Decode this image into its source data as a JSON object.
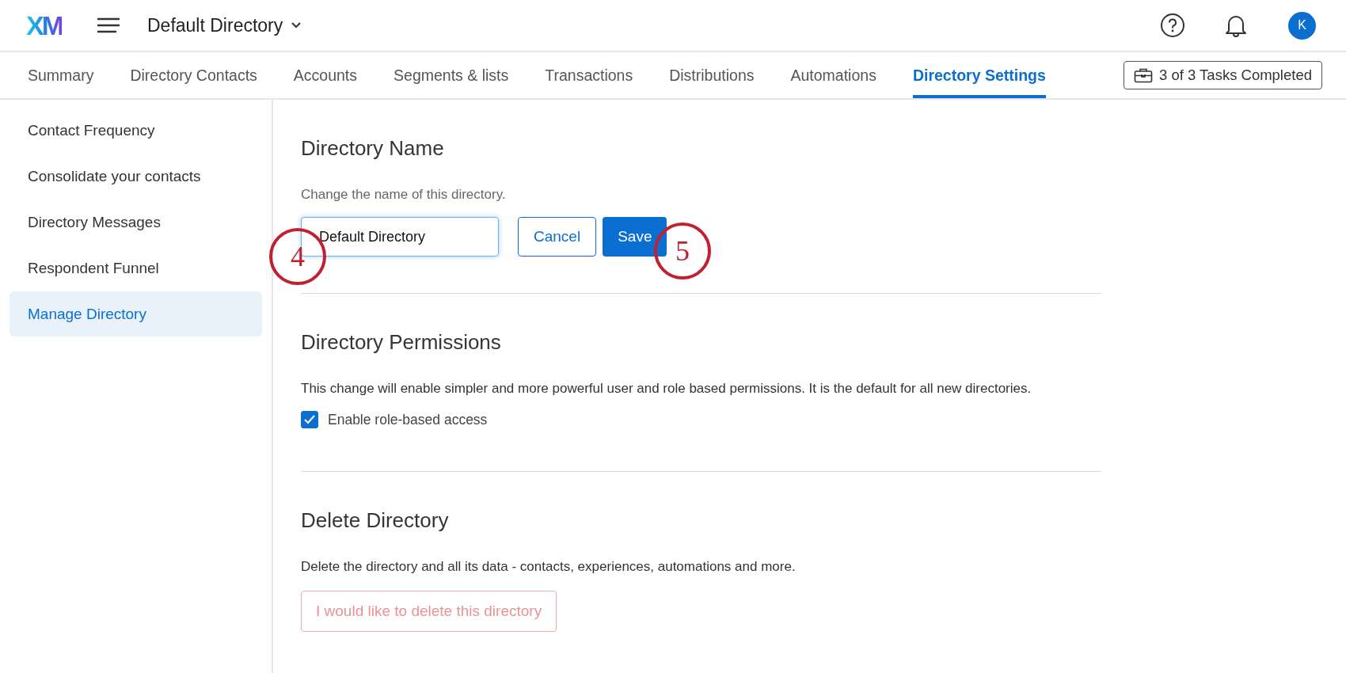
{
  "header": {
    "logo": "XM",
    "directory_title": "Default Directory",
    "avatar": "K"
  },
  "tabs": [
    {
      "label": "Summary",
      "selected": false
    },
    {
      "label": "Directory Contacts",
      "selected": false
    },
    {
      "label": "Accounts",
      "selected": false
    },
    {
      "label": "Segments & lists",
      "selected": false
    },
    {
      "label": "Transactions",
      "selected": false
    },
    {
      "label": "Distributions",
      "selected": false
    },
    {
      "label": "Automations",
      "selected": false
    },
    {
      "label": "Directory Settings",
      "selected": true
    }
  ],
  "tasks_button": "3 of 3 Tasks Completed",
  "sidebar": {
    "items": [
      {
        "label": "Contact Frequency",
        "selected": false
      },
      {
        "label": "Consolidate your contacts",
        "selected": false
      },
      {
        "label": "Directory Messages",
        "selected": false
      },
      {
        "label": "Respondent Funnel",
        "selected": false
      },
      {
        "label": "Manage Directory",
        "selected": true
      }
    ]
  },
  "name_section": {
    "title": "Directory Name",
    "description": "Change the name of this directory.",
    "value": "Default Directory",
    "cancel": "Cancel",
    "save": "Save"
  },
  "permissions_section": {
    "title": "Directory Permissions",
    "description": "This change will enable simpler and more powerful user and role based permissions. It is the default for all new directories.",
    "checkbox": {
      "label": "Enable role-based access",
      "checked": true
    }
  },
  "delete_section": {
    "title": "Delete Directory",
    "description": "Delete the directory and all its data - contacts, experiences, automations and more.",
    "button": {
      "label": "I would like to delete this directory",
      "disabled": true
    }
  },
  "callouts": [
    "4",
    "5"
  ]
}
